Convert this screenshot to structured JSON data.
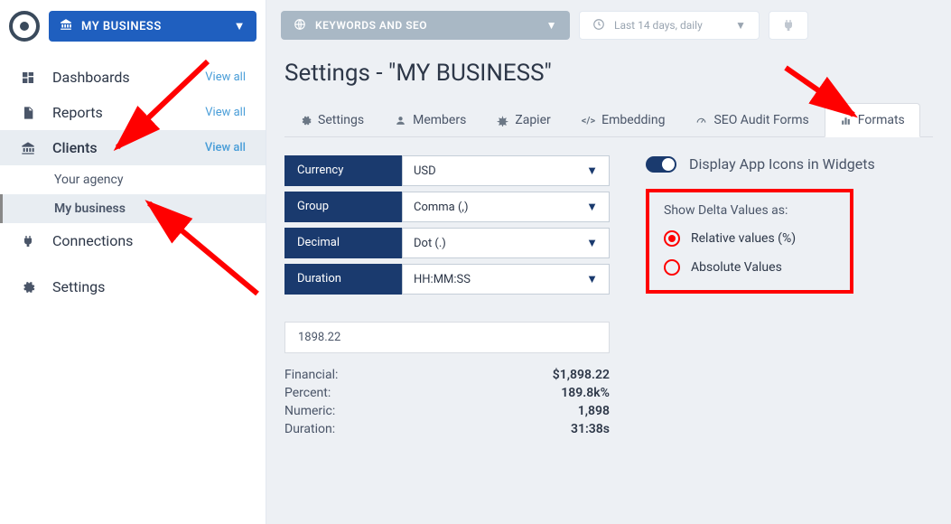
{
  "header": {
    "business_label": "MY BUSINESS",
    "keywords_label": "KEYWORDS AND SEO",
    "time_label": "Last 14 days, daily"
  },
  "sidebar": {
    "items": [
      {
        "label": "Dashboards",
        "view_all": "View all"
      },
      {
        "label": "Reports",
        "view_all": "View all"
      },
      {
        "label": "Clients",
        "view_all": "View all"
      },
      {
        "label": "Connections"
      },
      {
        "label": "Settings"
      }
    ],
    "clients_sub": [
      {
        "label": "Your agency"
      },
      {
        "label": "My business"
      }
    ]
  },
  "page": {
    "title": "Settings - \"MY BUSINESS\""
  },
  "tabs": [
    {
      "label": "Settings"
    },
    {
      "label": "Members"
    },
    {
      "label": "Zapier"
    },
    {
      "label": "Embedding"
    },
    {
      "label": "SEO Audit Forms"
    },
    {
      "label": "Formats"
    }
  ],
  "formats": {
    "rows": [
      {
        "label": "Currency",
        "value": "USD"
      },
      {
        "label": "Group",
        "value": "Comma (,)"
      },
      {
        "label": "Decimal",
        "value": "Dot (.)"
      },
      {
        "label": "Duration",
        "value": "HH:MM:SS"
      }
    ],
    "sample_input": "1898.22",
    "samples": [
      {
        "label": "Financial:",
        "value": "$1,898.22"
      },
      {
        "label": "Percent:",
        "value": "189.8k%"
      },
      {
        "label": "Numeric:",
        "value": "1,898"
      },
      {
        "label": "Duration:",
        "value": "31:38s"
      }
    ]
  },
  "right": {
    "toggle_label": "Display App Icons in Widgets",
    "delta_title": "Show Delta Values as:",
    "options": [
      {
        "label": "Relative values (%)",
        "checked": true
      },
      {
        "label": "Absolute Values",
        "checked": false
      }
    ]
  }
}
